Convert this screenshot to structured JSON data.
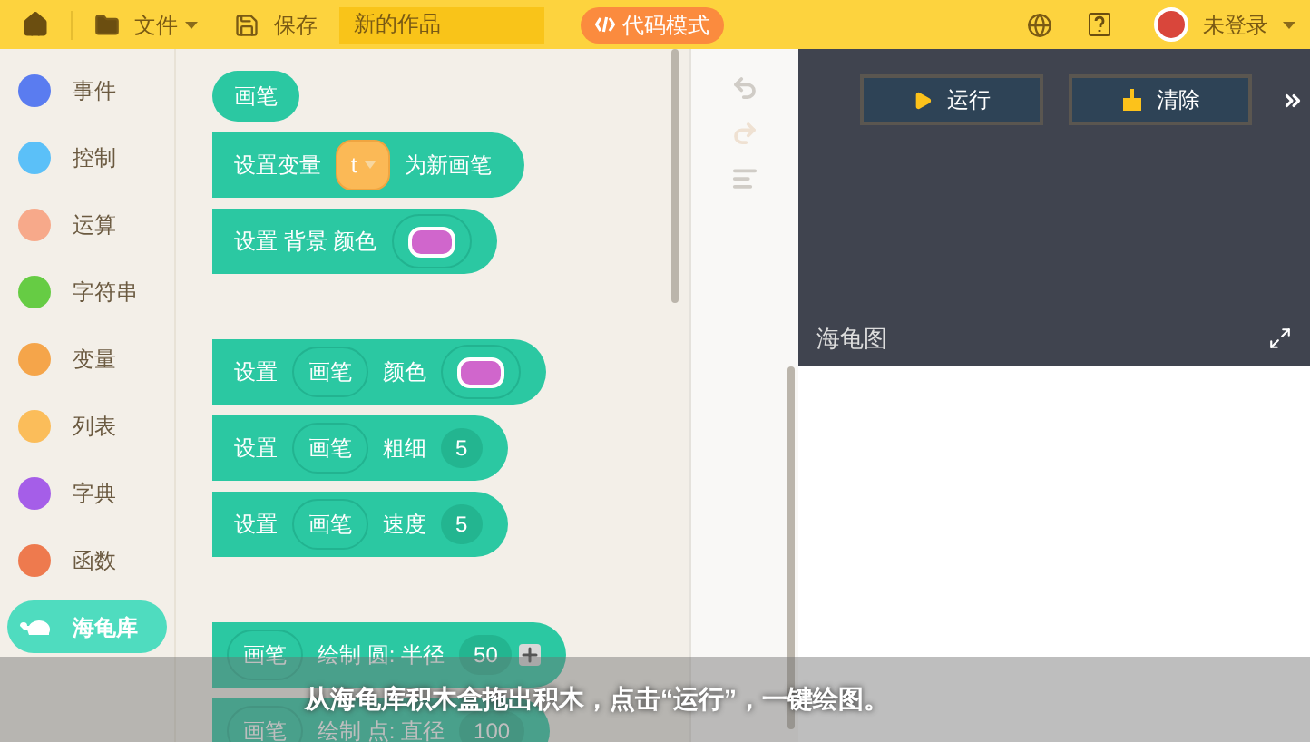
{
  "top_bar": {
    "file_menu": "文件",
    "save": "保存",
    "project_name": "新的作品",
    "code_mode": "代码模式",
    "user": "未登录"
  },
  "categories": [
    {
      "label": "事件",
      "color": "#5a7cf0",
      "selected": false
    },
    {
      "label": "控制",
      "color": "#5bc0f8",
      "selected": false
    },
    {
      "label": "运算",
      "color": "#f7a98a",
      "selected": false
    },
    {
      "label": "字符串",
      "color": "#66cc44",
      "selected": false
    },
    {
      "label": "变量",
      "color": "#f5a54a",
      "selected": false
    },
    {
      "label": "列表",
      "color": "#fbbd5a",
      "selected": false
    },
    {
      "label": "字典",
      "color": "#a55ee8",
      "selected": false
    },
    {
      "label": "函数",
      "color": "#ee7a4e",
      "selected": false
    },
    {
      "label": "海龟库",
      "color": "#4fdcbf",
      "selected": true
    }
  ],
  "block_groups": [
    {
      "blocks": [
        {
          "kind": "label",
          "parts": [
            {
              "kind": "text",
              "text": "画笔"
            }
          ]
        },
        {
          "kind": "statement",
          "parts": [
            {
              "kind": "text",
              "text": "设置变量"
            },
            {
              "kind": "variable",
              "text": "t"
            },
            {
              "kind": "text",
              "text": "为新画笔"
            }
          ]
        },
        {
          "kind": "statement",
          "parts": [
            {
              "kind": "text",
              "text": "设置 背景 颜色"
            },
            {
              "kind": "color",
              "color": "#d066cc"
            }
          ]
        }
      ]
    },
    {
      "blocks": [
        {
          "kind": "statement",
          "parts": [
            {
              "kind": "text",
              "text": "设置"
            },
            {
              "kind": "slot",
              "text": "画笔"
            },
            {
              "kind": "text",
              "text": "颜色"
            },
            {
              "kind": "color",
              "color": "#d066cc"
            }
          ]
        },
        {
          "kind": "statement",
          "parts": [
            {
              "kind": "text",
              "text": "设置"
            },
            {
              "kind": "slot",
              "text": "画笔"
            },
            {
              "kind": "text",
              "text": "粗细"
            },
            {
              "kind": "number",
              "text": "5"
            }
          ]
        },
        {
          "kind": "statement",
          "parts": [
            {
              "kind": "text",
              "text": "设置"
            },
            {
              "kind": "slot",
              "text": "画笔"
            },
            {
              "kind": "text",
              "text": "速度"
            },
            {
              "kind": "number",
              "text": "5"
            }
          ]
        }
      ]
    },
    {
      "blocks": [
        {
          "kind": "statement",
          "parts": [
            {
              "kind": "slot",
              "text": "画笔"
            },
            {
              "kind": "text",
              "text": "绘制 圆: 半径"
            },
            {
              "kind": "number",
              "text": "50"
            },
            {
              "kind": "plus"
            }
          ]
        },
        {
          "kind": "statement",
          "parts": [
            {
              "kind": "slot",
              "text": "画笔"
            },
            {
              "kind": "text",
              "text": "绘制 点: 直径"
            },
            {
              "kind": "number",
              "text": "100"
            }
          ]
        }
      ]
    }
  ],
  "stage": {
    "run": "运行",
    "clear": "清除",
    "title": "海龟图"
  },
  "caption": "从海龟库积木盒拖出积木，点击“运行”，一键绘图。"
}
